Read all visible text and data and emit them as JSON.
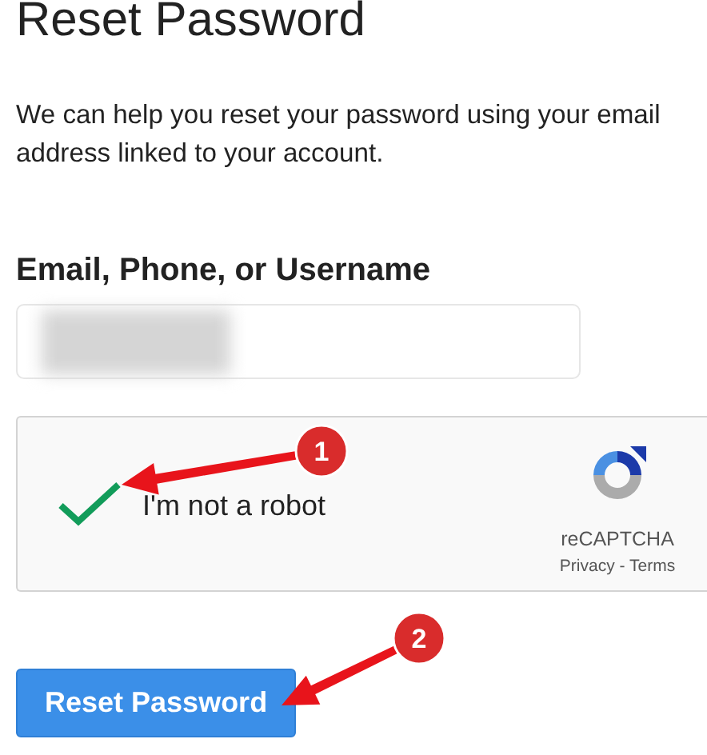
{
  "title": "Reset Password",
  "description": "We can help you reset your password using your email address linked to your account.",
  "email_field": {
    "label": "Email, Phone, or Username",
    "redacted": true
  },
  "recaptcha": {
    "checked": true,
    "label": "I'm not a robot",
    "brand": "reCAPTCHA",
    "links": "Privacy - Terms"
  },
  "submit_button": "Reset Password",
  "callouts": [
    {
      "number": "1",
      "kind": "recaptcha"
    },
    {
      "number": "2",
      "kind": "submit"
    }
  ]
}
